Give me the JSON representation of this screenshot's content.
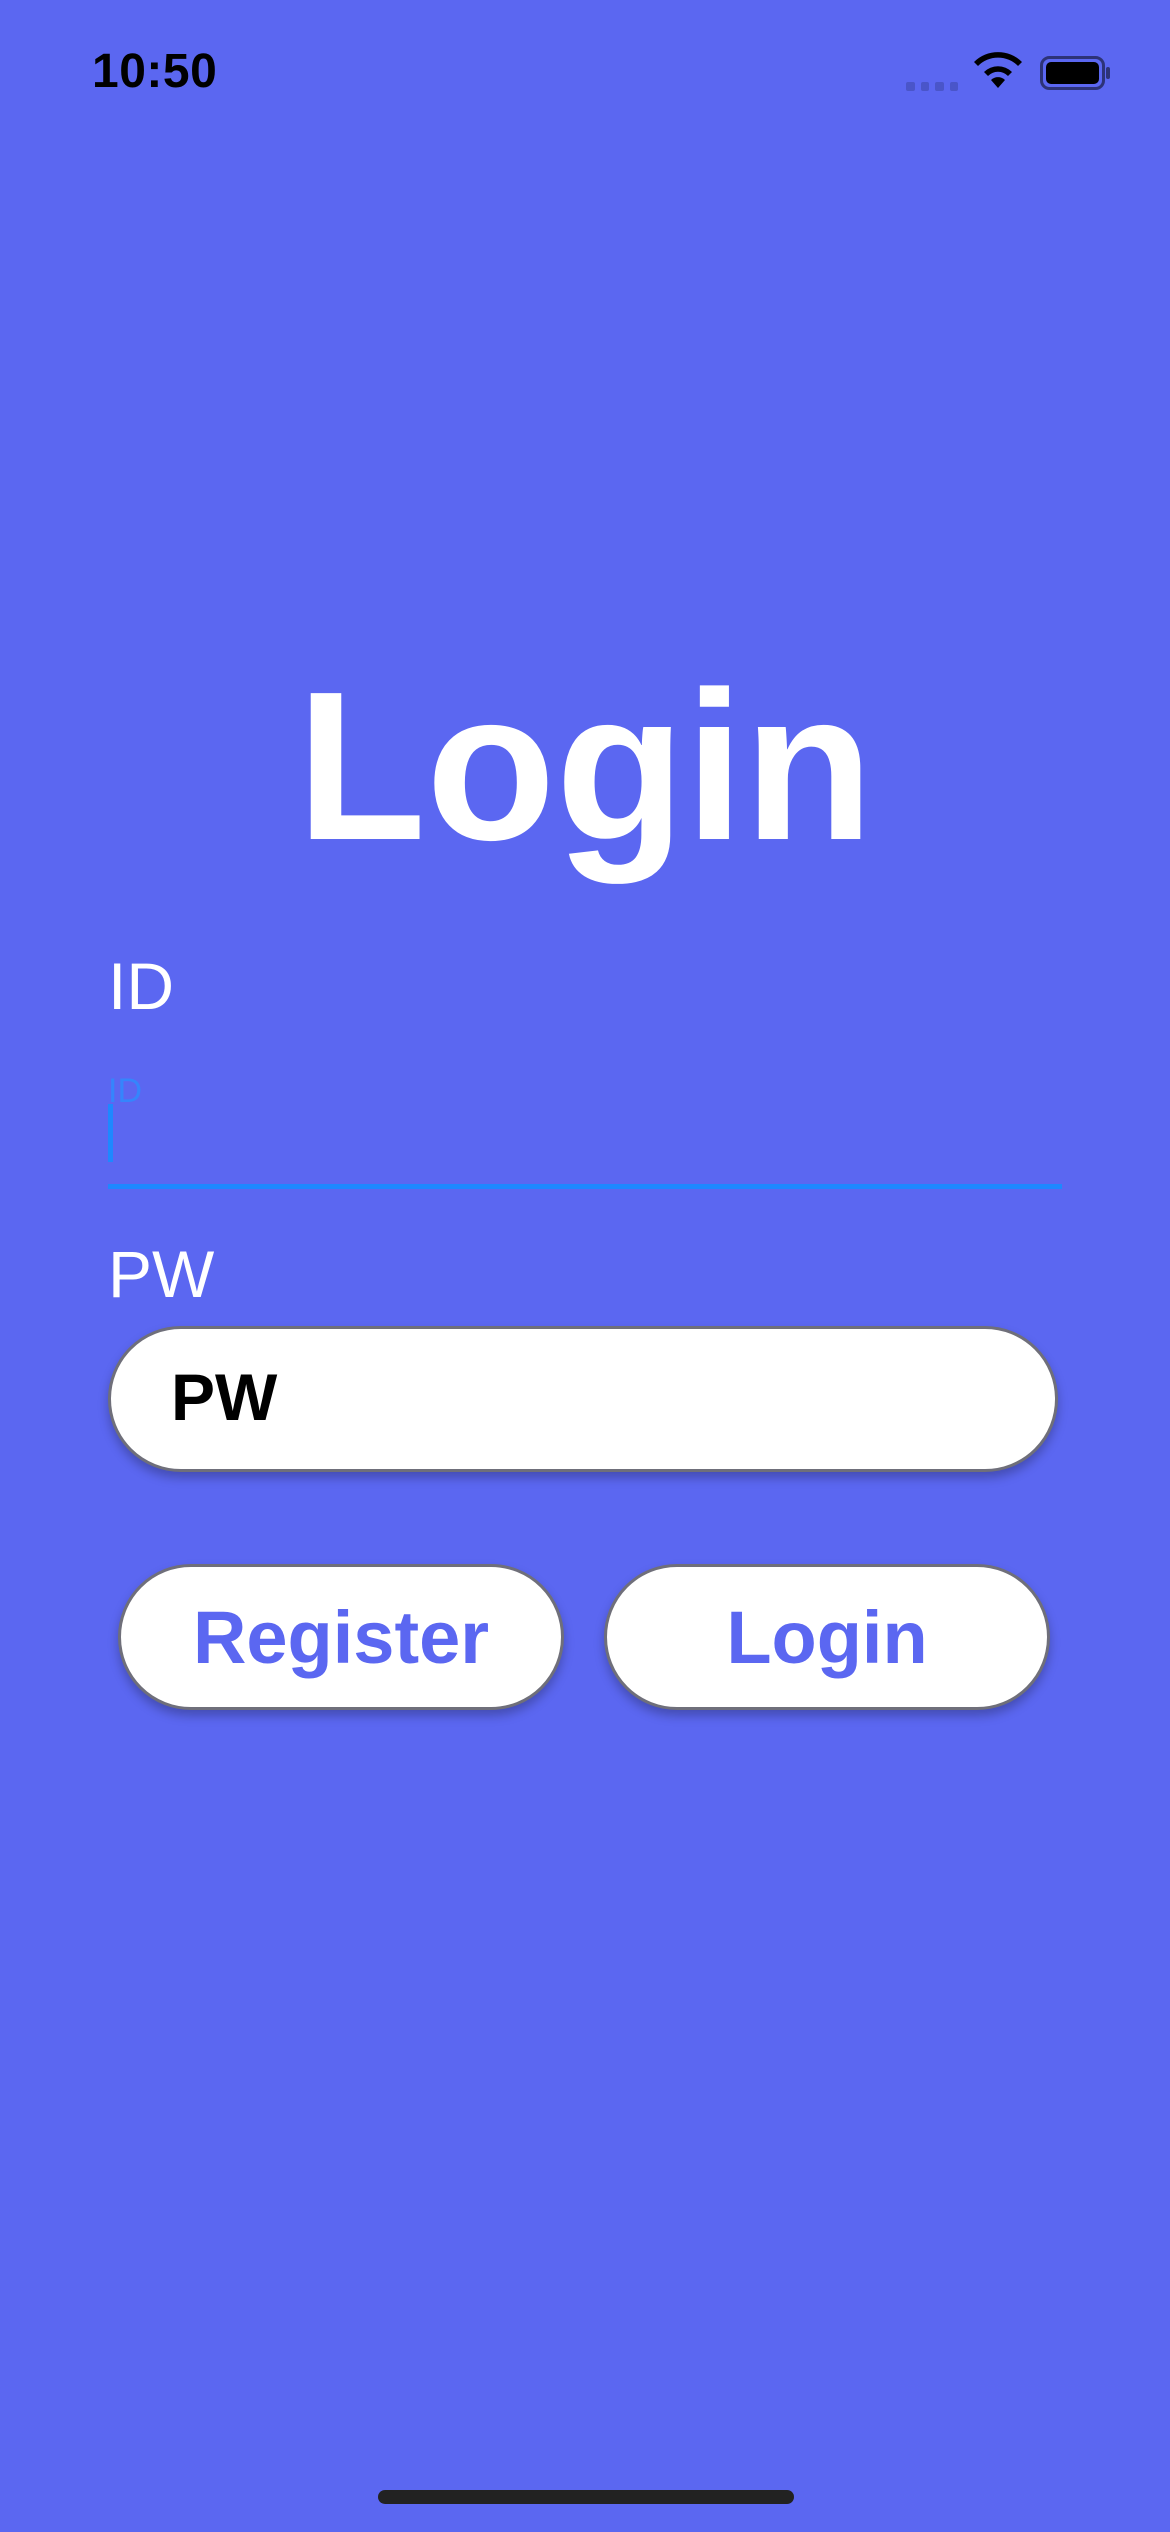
{
  "status_bar": {
    "time": "10:50"
  },
  "title": "Login",
  "id_field": {
    "label": "ID",
    "placeholder": "ID",
    "value": ""
  },
  "pw_field": {
    "label": "PW",
    "value": "PW"
  },
  "buttons": {
    "register_label": "Register",
    "login_label": "Login"
  },
  "colors": {
    "background": "#5B67F1",
    "accent_text": "#5B67F1",
    "focus_blue": "#1E88FF",
    "white": "#FFFFFF"
  },
  "icons": {
    "signal": "cellular-signal-icon",
    "wifi": "wifi-icon",
    "battery": "battery-icon"
  }
}
